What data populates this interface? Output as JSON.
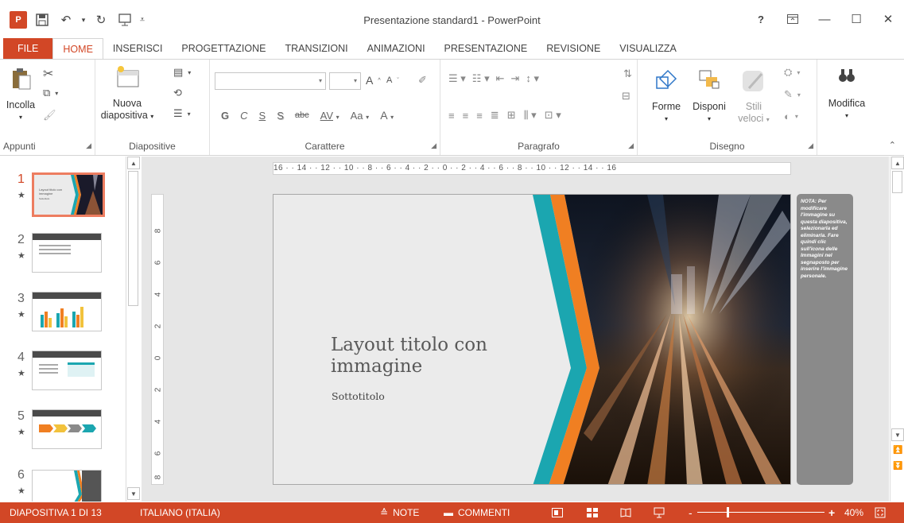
{
  "window": {
    "title": "Presentazione standard1 - PowerPoint",
    "help": "?",
    "app_icon": "P"
  },
  "tabs": [
    "FILE",
    "HOME",
    "INSERISCI",
    "PROGETTAZIONE",
    "TRANSIZIONI",
    "ANIMAZIONI",
    "PRESENTAZIONE",
    "REVISIONE",
    "VISUALIZZA"
  ],
  "active_tab": "HOME",
  "ribbon": {
    "clipboard": {
      "label": "Appunti",
      "paste": "Incolla"
    },
    "slides": {
      "label": "Diapositive",
      "new_slide_line1": "Nuova",
      "new_slide_line2": "diapositiva"
    },
    "font": {
      "label": "Carattere",
      "bold": "G",
      "italic": "C",
      "underline": "S",
      "shadow": "S",
      "strike": "abc",
      "spacing": "AV",
      "case": "Aa",
      "color": "A",
      "grow": "A",
      "shrink": "A"
    },
    "paragraph": {
      "label": "Paragrafo"
    },
    "drawing": {
      "label": "Disegno",
      "shapes": "Forme",
      "arrange": "Disponi",
      "quick_styles_line1": "Stili",
      "quick_styles_line2": "veloci"
    },
    "editing": {
      "label": "Modifica"
    }
  },
  "thumbnails": [
    {
      "num": "1",
      "selected": true,
      "title": "Layout titolo con immagine",
      "subtitle": "Sottotitolo"
    },
    {
      "num": "2",
      "selected": false
    },
    {
      "num": "3",
      "selected": false
    },
    {
      "num": "4",
      "selected": false
    },
    {
      "num": "5",
      "selected": false
    },
    {
      "num": "6",
      "selected": false
    }
  ],
  "ruler": {
    "horizontal": "16 · · 14 · · 12 · · 10 · · 8 · · 6 · · 4 · · 2 · · 0 · · 2 · · 4 · · 6 · · 8 · · 10 · · 12 · · 14 · · 16",
    "vertical": [
      "8",
      "6",
      "4",
      "2",
      "0",
      "2",
      "4",
      "6",
      "8"
    ]
  },
  "slide": {
    "title": "Layout titolo con immagine",
    "subtitle": "Sottotitolo"
  },
  "note": {
    "text": "NOTA: Per modificare l'immagine su questa diapositiva, selezionarla ed eliminarla. Fare quindi clic sull'icona delle Immagini nel segnaposto per inserire l'immagine personale."
  },
  "status": {
    "slide_count": "DIAPOSITIVA 1 DI 13",
    "language": "ITALIANO (ITALIA)",
    "notes": "NOTE",
    "comments": "COMMENTI",
    "zoom": "40%",
    "zoom_minus": "-",
    "zoom_plus": "+"
  },
  "colors": {
    "accent": "#d24726",
    "teal": "#1ba6b0",
    "orange": "#f07f22"
  }
}
